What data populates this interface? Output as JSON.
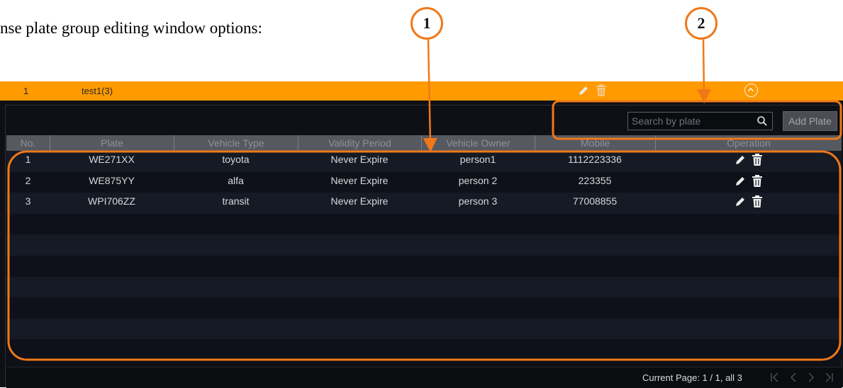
{
  "doc": {
    "intro_text": "nse plate group editing window options:"
  },
  "callouts": [
    "1",
    "2"
  ],
  "accent_color": "#ff9a00",
  "callout_color": "#f07818",
  "group": {
    "number": "1",
    "name": "test1(3)",
    "edit_icon": "pencil-icon",
    "delete_icon": "trash-icon",
    "collapse_icon": "chevron-up-circle-icon"
  },
  "toolbar": {
    "search_placeholder": "Search by plate",
    "search_icon": "search-icon",
    "add_label": "Add Plate"
  },
  "table": {
    "headers": [
      "No.",
      "Plate",
      "Vehicle Type",
      "Validity Period",
      "Vehicle Owner",
      "Mobile",
      "Operation"
    ],
    "rows": [
      {
        "no": "1",
        "plate": "WE271XX",
        "type": "toyota",
        "validity": "Never Expire",
        "owner": "person1",
        "mobile": "1112223336"
      },
      {
        "no": "2",
        "plate": "WE875YY",
        "type": "alfa",
        "validity": "Never Expire",
        "owner": "person 2",
        "mobile": "223355"
      },
      {
        "no": "3",
        "plate": "WPI706ZZ",
        "type": "transit",
        "validity": "Never Expire",
        "owner": "person 3",
        "mobile": "77008855"
      }
    ]
  },
  "pagination": {
    "text": "Current Page: 1 / 1, all 3",
    "icons": [
      "first-page-icon",
      "previous-page-icon",
      "next-page-icon",
      "last-page-icon"
    ]
  }
}
